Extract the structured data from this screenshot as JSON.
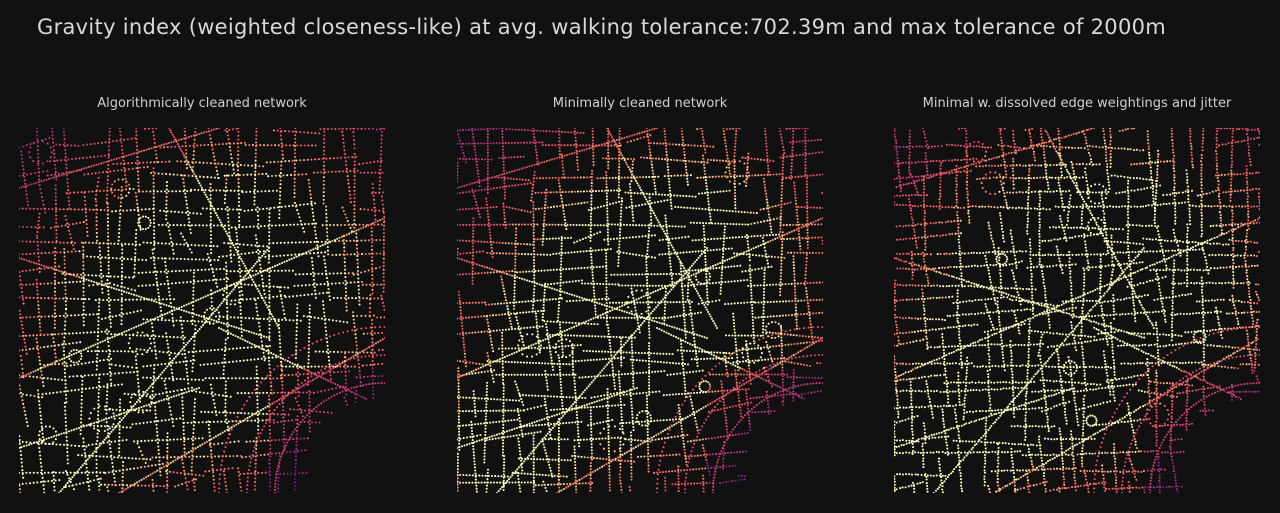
{
  "figure": {
    "title": "Gravity index (weighted closeness-like) at avg. walking tolerance:702.39m and max tolerance of 2000m"
  },
  "colors": {
    "background": "#111111",
    "colormap": "magma",
    "low": "#2d1160",
    "mid": "#d3436e",
    "high": "#fcfdbf"
  },
  "panels": [
    {
      "title": "Algorithmically cleaned network"
    },
    {
      "title": "Minimally cleaned network"
    },
    {
      "title": "Minimal w. dissolved edge weightings and jitter"
    }
  ]
}
